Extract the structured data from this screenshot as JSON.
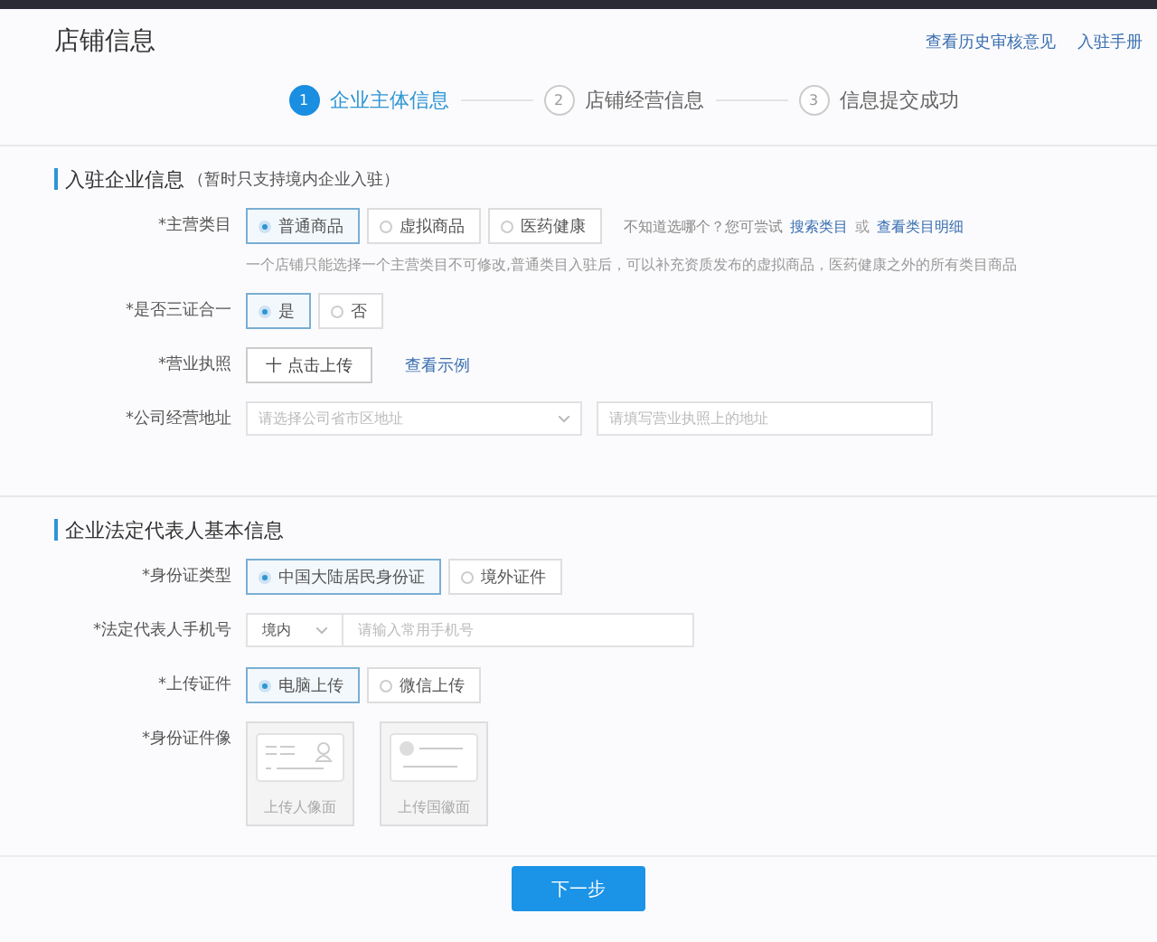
{
  "header": {
    "title": "店铺信息",
    "links": [
      "查看历史审核意见",
      "入驻手册"
    ]
  },
  "steps": [
    {
      "number": "1",
      "label": "企业主体信息",
      "selected": true
    },
    {
      "number": "2",
      "label": "店铺经营信息",
      "selected": false
    },
    {
      "number": "3",
      "label": "信息提交成功",
      "selected": false
    }
  ],
  "sections": [
    {
      "title": "入驻企业信息",
      "note": "（暂时只支持境内企业入驻）",
      "fields": [
        {
          "kind": "radio",
          "label": "*主营类目",
          "options": [
            {
              "label": "普通商品",
              "selected": true
            },
            {
              "label": "虚拟商品",
              "selected": false
            },
            {
              "label": "医药健康",
              "selected": false
            }
          ],
          "tip": "不知道选哪个？您可尝试",
          "tip_links": [
            "搜索类目",
            "查看类目明细"
          ],
          "tip_joiner": "或",
          "hint": "一个店铺只能选择一个主营类目不可修改,普通类目入驻后，可以补充资质发布的虚拟商品，医药健康之外的所有类目商品"
        },
        {
          "kind": "radio",
          "label": "*是否三证合一",
          "options": [
            {
              "label": "是",
              "selected": true
            },
            {
              "label": "否",
              "selected": false
            }
          ]
        },
        {
          "kind": "upload",
          "label": "*营业执照",
          "button": "十 点击上传",
          "link": "查看示例"
        },
        {
          "kind": "address",
          "label": "*公司经营地址",
          "select_placeholder": "请选择公司省市区地址",
          "input_placeholder": "请填写营业执照上的地址"
        }
      ]
    },
    {
      "title": "企业法定代表人基本信息",
      "fields": [
        {
          "kind": "radio",
          "label": "*身份证类型",
          "options": [
            {
              "label": "中国大陆居民身份证",
              "selected": true
            },
            {
              "label": "境外证件",
              "selected": false
            }
          ]
        },
        {
          "kind": "phone",
          "label": "*法定代表人手机号",
          "region": "境内",
          "placeholder": "请输入常用手机号"
        },
        {
          "kind": "radio",
          "label": "*上传证件",
          "options": [
            {
              "label": "电脑上传",
              "selected": true
            },
            {
              "label": "微信上传",
              "selected": false
            }
          ]
        },
        {
          "kind": "images",
          "label": "*身份证件像",
          "cards": [
            {
              "kind": "portrait",
              "caption": "上传人像面"
            },
            {
              "kind": "emblem",
              "caption": "上传国徽面"
            }
          ]
        }
      ]
    }
  ],
  "next_button": "下一步"
}
